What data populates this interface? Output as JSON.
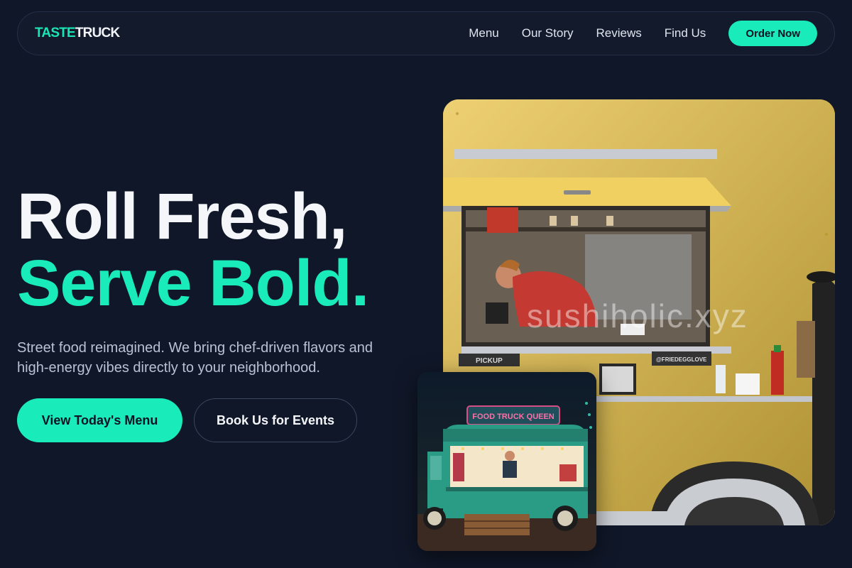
{
  "nav": {
    "logo_part1": "TASTE",
    "logo_part2": "TRUCK",
    "links": [
      "Menu",
      "Our Story",
      "Reviews",
      "Find Us"
    ],
    "cta": "Order Now"
  },
  "hero": {
    "headline_line1": "Roll Fresh,",
    "headline_line2": "Serve Bold.",
    "subtitle": "Street food reimagined. We bring chef-driven flavors and high-energy vibes directly to your neighborhood.",
    "primary_button": "View Today's Menu",
    "secondary_button": "Book Us for Events"
  },
  "images": {
    "main_watermark": "sushiholic.xyz",
    "main_window_label_left": "PICKUP",
    "main_window_label_right": "@FRIEDEGGLOVE",
    "inset_sign": "FOOD TRUCK QUEEN"
  },
  "colors": {
    "background": "#101728",
    "accent": "#19ebbb",
    "truck_yellow": "#e7c042",
    "truck_teal": "#2a9c86"
  }
}
